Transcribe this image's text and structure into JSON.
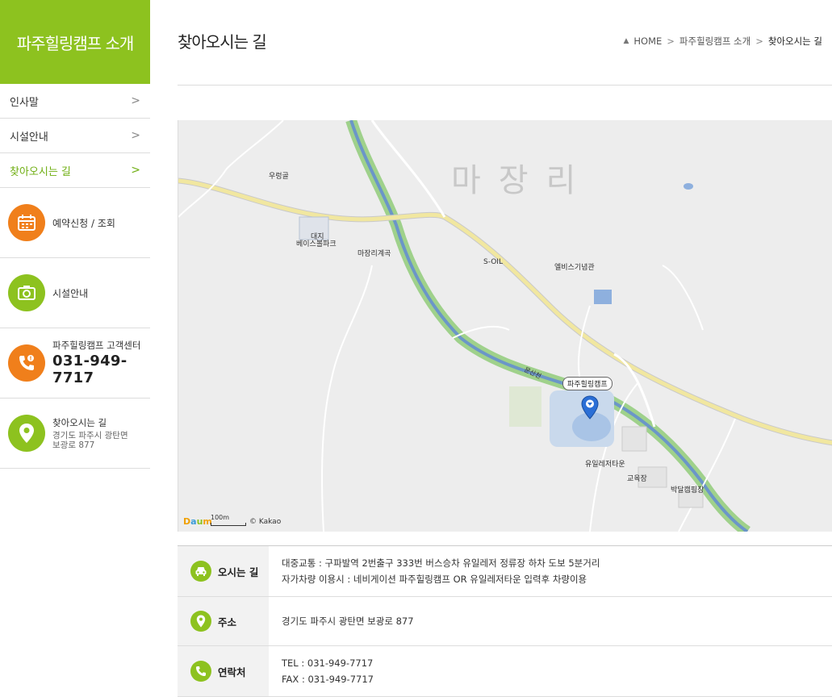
{
  "sidebar": {
    "title": "파주힐링캠프 소개",
    "menu": [
      {
        "label": "인사말",
        "chevron": ">"
      },
      {
        "label": "시설안내",
        "chevron": ">"
      },
      {
        "label": "찾아오시는 길",
        "chevron": ">"
      }
    ],
    "quick": {
      "reservation": "예약신청 / 조회",
      "facility": "시설안내",
      "center_title": "파주힐링캠프 고객센터",
      "center_phone": "031-949-7717",
      "directions_title": "찾아오시는 길",
      "directions_addr1": "경기도 파주시 광탄면",
      "directions_addr2": "보광로 877"
    }
  },
  "header": {
    "page_title": "찾아오시는 길",
    "breadcrumb": [
      "HOME",
      "파주힐링캠프 소개",
      "찾아오시는 길"
    ]
  },
  "map": {
    "region_name": "마장리",
    "pin_label": "파주힐링캠프",
    "places": {
      "p1": "우렁골",
      "p2": "대지",
      "p3": "베이스볼파크",
      "p4": "마장리계곡",
      "p5": "S-OIL",
      "p6": "엘비스기념관",
      "p7": "유일레저타운",
      "p8": "교육장",
      "p9": "박달캠핑장",
      "p10": "문산천"
    },
    "scale": "100m",
    "copyright": "© Kakao",
    "logo": "Daum"
  },
  "info": {
    "route": {
      "head": "오시는 길",
      "line1": "대중교통 : 구파발역 2번출구 333번 버스승차 유일레저 정류장 하차 도보 5분거리",
      "line2": "자가차량 이용시 : 네비게이션 파주힐링캠프 OR 유일레저타운 입력후 차량이용"
    },
    "address": {
      "head": "주소",
      "value": "경기도 파주시 광탄면 보광로 877"
    },
    "contact": {
      "head": "연락처",
      "tel": "TEL : 031-949-7717",
      "fax": "FAX : 031-949-7717"
    }
  },
  "colors": {
    "accent_green": "#8dc21f",
    "accent_orange": "#f07f1b",
    "river_green": "#9fd18b",
    "river_blue": "#6b96c8",
    "road_yellow": "#f1e7a0"
  }
}
